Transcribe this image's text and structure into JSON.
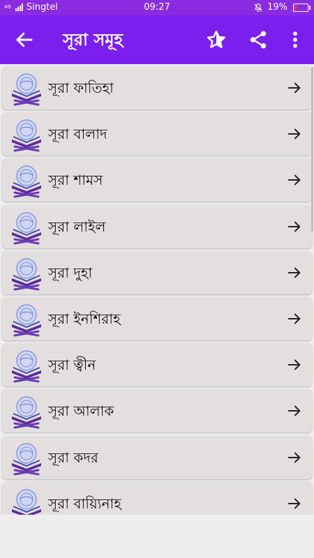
{
  "status": {
    "carrier": "Singtel",
    "time": "09:27",
    "battery": "19%",
    "battery_level": 0.19,
    "signal_text": "4G"
  },
  "appbar": {
    "title": "সূরা সমূহ",
    "back_icon": "arrow-left-icon",
    "favorite_icon": "star-icon",
    "share_icon": "share-icon",
    "menu_icon": "more-vert-icon"
  },
  "colors": {
    "status": "#8a2be2",
    "appbar": "#7b1fee",
    "row_bg": "#e3dfdf"
  },
  "items": [
    {
      "label": "সূরা ফাতিহা"
    },
    {
      "label": "সূরা বালাদ"
    },
    {
      "label": "সূরা শামস"
    },
    {
      "label": "সূরা লাইল"
    },
    {
      "label": "সূরা দুহা"
    },
    {
      "label": "সূরা ইনশিরাহ"
    },
    {
      "label": "সূরা ত্বীন"
    },
    {
      "label": "সূরা আলাক"
    },
    {
      "label": "সূরা কদর"
    },
    {
      "label": "সূরা বায়্যিনাহ"
    }
  ]
}
